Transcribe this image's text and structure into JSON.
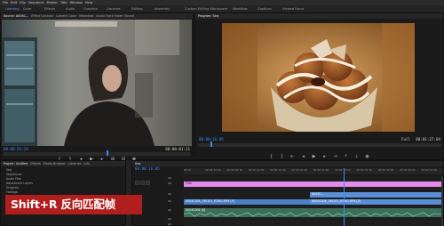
{
  "menubar": {
    "items": [
      "File",
      "Edit",
      "Clip",
      "Sequence",
      "Marker",
      "Title",
      "Window",
      "Help"
    ]
  },
  "workspaces": {
    "items": [
      "Learning",
      "Color",
      "Effects",
      "Audio",
      "Graphics",
      "Libraries",
      "Editing",
      "Assembly",
      "Custom Editing Workspace",
      "Workflow",
      "Captions",
      "Viewed Focus"
    ],
    "active_index": 0
  },
  "source_monitor": {
    "tabs": [
      "Source: A004C...",
      "Effect Controls",
      "Lumetri Color",
      "Metadata",
      "Audio Track Mixer: Sound"
    ],
    "timecode_left": "00:00:03:24",
    "timecode_right": "00:00:01:21",
    "scrub_progress": 0.55
  },
  "program_monitor": {
    "tabs": [
      "Program: Seq"
    ],
    "timecode_left": "00:00:16:05",
    "zoom": "Full",
    "timecode_right": "00:01:27:04",
    "scrub_progress": 0.05
  },
  "project_panel": {
    "tabs": [
      "Project: Untitled",
      "Effects",
      "Media Browser",
      "Libraries",
      "Info"
    ],
    "rows": [
      "Seq",
      "Sequences",
      "Audio Files",
      "Adjustment Layers",
      "Graphics",
      "Footage",
      "A004C...",
      "A004C..."
    ]
  },
  "timeline": {
    "sequence_tab": "Seq",
    "timecode": "00:00:16:05",
    "ruler_labels": [
      "00:00",
      "00:00:04:00",
      "00:00:08:00",
      "00:00:12:00",
      "00:00:16:00",
      "00:00:20:00",
      "00:00:24:00",
      "00:00:28:00",
      "00:00:32:00",
      "00:00:36:00",
      "00:00:40:00",
      "00:00:44:00"
    ],
    "playhead_fraction": 0.615,
    "tracks": [
      "V4",
      "V3",
      "V2",
      "V1",
      "A1",
      "A2",
      "A3"
    ],
    "clips": {
      "title_clip": "Title",
      "v2_clip": "A004C...",
      "v1_clip_a": "A004C004_190101_R2WG.MP4 [V]",
      "v1_clip_b": "A004C004_190101_R2WG.MP4 [V]",
      "a1_clip": "A004C004 [A]"
    }
  },
  "caption": {
    "text": "Shift+R 反向匹配帧"
  },
  "colors": {
    "timecode_blue": "#3d8bf5",
    "clip_pink": "#e28ae9",
    "clip_video_blue": "#5a8fd8",
    "clip_audio_green": "#3b6f5a",
    "caption_red": "#b11e1e"
  }
}
